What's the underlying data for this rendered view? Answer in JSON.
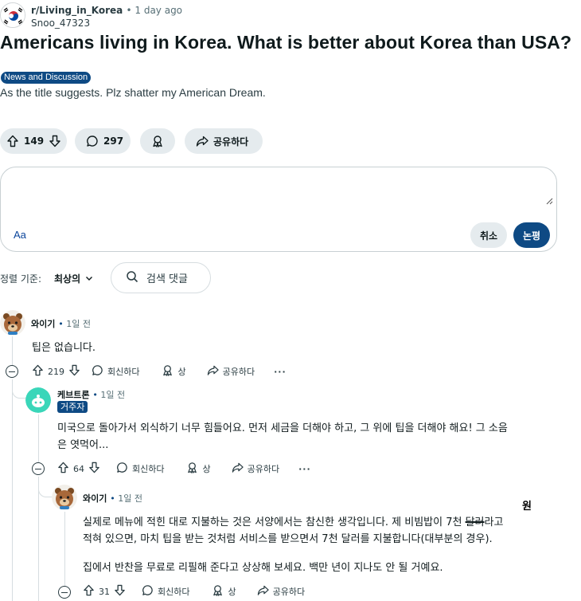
{
  "post": {
    "subreddit": "r/Living_in_Korea",
    "time": "1 day ago",
    "author": "Snoo_47323",
    "title": "Americans living in Korea. What is better about Korea than USA?",
    "flair": "News and Discussion",
    "body": "As the title suggests. Plz shatter my American Dream.",
    "upvotes": "149",
    "comments": "297",
    "share_label": "공유하다"
  },
  "composer": {
    "format_label": "Aa",
    "cancel_label": "취소",
    "submit_label": "논평"
  },
  "sort": {
    "label": "정렬 기준:",
    "value": "최상의",
    "search_label": "검색 댓글"
  },
  "comments": [
    {
      "author": "와이기",
      "time": "1일 전",
      "text": "팁은 없습니다.",
      "votes": "219",
      "reply_label": "회신하다",
      "award_label": "상",
      "share_label": "공유하다"
    },
    {
      "author": "케브트론",
      "time": "1일 전",
      "flair": "거주자",
      "text_line1": "미국으로 돌아가서 외식하기 너무 힘들어요. 먼저 세금을 더해야 하고, 그 위에 팁을 더해야 해요! 그 소음",
      "text_line2": "은 엿먹어...",
      "votes": "64",
      "reply_label": "회신하다",
      "award_label": "상",
      "share_label": "공유하다"
    },
    {
      "author": "와이기",
      "time": "1일 전",
      "text_line1_a": "실제로 메뉴에 적힌 대로 지불하는 것은 서양에서는 참신한 생각입니다. 제 비빔밥이 7천 ",
      "text_line1_strike": "달러",
      "text_line1_b": "라고",
      "text_line2": "적혀 있으면, 마치 팁을 받는 것처럼 서비스를 받으면서 7천 달러를 지불합니다(대부분의 경우).",
      "text_line3": "집에서 반찬을 무료로 리필해 준다고 상상해 보세요. 백만 년이 지나도 안 될 거예요.",
      "annotation": "원",
      "votes": "31",
      "reply_label": "회신하다",
      "award_label": "상",
      "share_label": "공유하다"
    }
  ],
  "icons": [
    "upvote-icon",
    "downvote-icon",
    "comment-icon",
    "award-icon",
    "share-icon",
    "search-icon",
    "chevron-down-icon",
    "collapse-icon",
    "more-icon"
  ],
  "colors": {
    "accent": "#0e4a84",
    "pill_bg": "#e5ebee",
    "text": "#0f1a1c",
    "muted": "#576f76"
  }
}
